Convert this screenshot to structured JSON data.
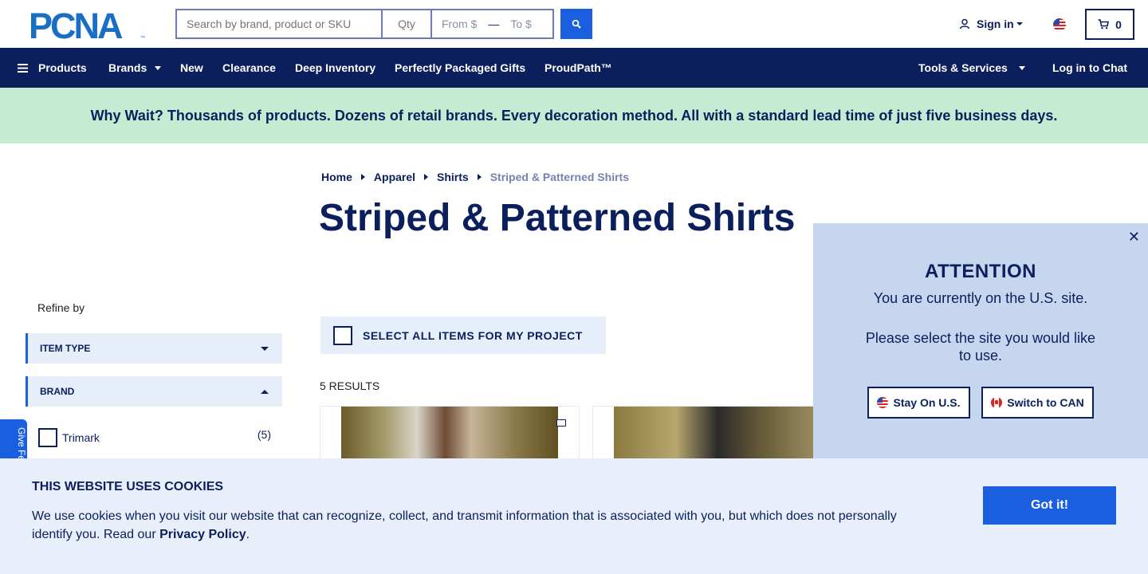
{
  "header": {
    "logo_text": "PCNA",
    "search_placeholder": "Search by brand, product or SKU",
    "qty_placeholder": "Qty",
    "price_from_placeholder": "From $",
    "price_to_placeholder": "To $",
    "sign_in_label": "Sign in",
    "cart_count": "0"
  },
  "nav": {
    "products": "Products",
    "brands": "Brands",
    "new": "New",
    "clearance": "Clearance",
    "deep_inventory": "Deep Inventory",
    "gifts": "Perfectly Packaged Gifts",
    "proudpath": "ProudPath™",
    "tools": "Tools & Services",
    "chat": "Log in to Chat"
  },
  "promo": "Why Wait? Thousands of products. Dozens of retail brands. Every decoration method. All with a standard lead time of just five business days.",
  "breadcrumb": [
    "Home",
    "Apparel",
    "Shirts",
    "Striped & Patterned Shirts"
  ],
  "page_title": "Striped & Patterned Shirts",
  "sidebar": {
    "refine_label": "Refine by",
    "facets": [
      "ITEM TYPE",
      "BRAND"
    ],
    "brand_option": {
      "label": "Trimark",
      "count": "(5)"
    },
    "feedback_label": "Give Fe"
  },
  "main": {
    "select_all_label": "SELECT ALL ITEMS FOR MY PROJECT",
    "results_label": "5 RESULTS"
  },
  "attention": {
    "title": "ATTENTION",
    "line1": "You are currently on the U.S. site.",
    "line2": "Please select the site you would like to use.",
    "stay_label": "Stay On U.S.",
    "switch_label": "Switch to CAN",
    "close_glyph": "✕"
  },
  "cookie": {
    "title": "THIS WEBSITE USES COOKIES",
    "body": "We use cookies when you visit our website that can recognize, collect, and transmit information that is associated with you, but which does not personally identify you. Read our ",
    "link": "Privacy Policy",
    "end": ".",
    "button": "Got it!"
  },
  "colors": {
    "navy": "#0a1f5c",
    "accent_blue": "#1a5fe0",
    "promo_green": "#c5ecd3",
    "panel_blue": "#c6d6ee"
  }
}
